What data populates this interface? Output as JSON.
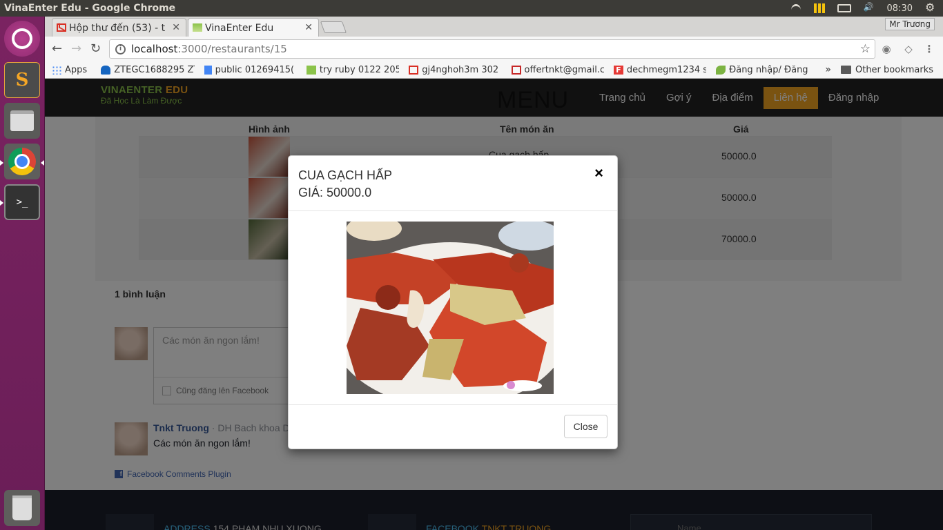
{
  "window": {
    "title": "VinaEnter Edu - Google Chrome"
  },
  "system_tray": {
    "clock": "08:30"
  },
  "launcher": {
    "items": [
      "ubuntu-dash",
      "sublime-text",
      "files",
      "chrome",
      "terminal",
      "trash"
    ]
  },
  "browser": {
    "tabs": [
      {
        "label": "Hộp thư đến (53) - t",
        "icon": "gmail-icon"
      },
      {
        "label": "VinaEnter Edu",
        "icon": "vinaenter-favicon",
        "active": true
      }
    ],
    "profile": "Mr Trương",
    "url": {
      "host": "localhost",
      "path": ":3000/restaurants/15"
    },
    "bookmarks": [
      {
        "label": "Apps",
        "icon": "apps-icon",
        "color": "#4285f4"
      },
      {
        "label": "ZTEGC1688295 ZT",
        "icon": "cloud-icon",
        "color": "#1565c0"
      },
      {
        "label": "public 01269415(",
        "icon": "docs-icon",
        "color": "#4285f4"
      },
      {
        "label": "try ruby 0122 205",
        "icon": "image-icon",
        "color": "#8bc34a"
      },
      {
        "label": "gj4nghoh3m  302",
        "icon": "gmail-icon",
        "color": "#d93025"
      },
      {
        "label": "offertnkt@gmail.c",
        "icon": "mail-icon",
        "color": "#c62828"
      },
      {
        "label": "dechmegm1234  s",
        "icon": "f-icon",
        "color": "#e53935"
      },
      {
        "label": "Đăng nhập/ Đăng",
        "icon": "leaf-icon",
        "color": "#7cb342"
      }
    ],
    "bookmarks_more": "»",
    "other_bookmarks": "Other bookmarks"
  },
  "site": {
    "logo": {
      "line1a": "VINAENTER",
      "line1b": " EDU",
      "line2": "Đã Học Là Làm Được"
    },
    "menu_heading": "MENU",
    "nav": [
      {
        "label": "Trang chủ"
      },
      {
        "label": "Gợi ý"
      },
      {
        "label": "Địa điểm"
      },
      {
        "label": "Liên hệ",
        "active": true
      },
      {
        "label": "Đăng nhập"
      }
    ],
    "table": {
      "headers": {
        "image": "Hình ảnh",
        "name": "Tên món ăn",
        "price": "Giá"
      },
      "rows": [
        {
          "name": "Cua gạch hấp",
          "price": "50000.0"
        },
        {
          "name": "",
          "price": "50000.0"
        },
        {
          "name": "",
          "price": "70000.0"
        }
      ]
    },
    "comments": {
      "count_label": "1 bình luận",
      "input_placeholder": "Các món ăn ngon lắm!",
      "also_post": "Cũng đăng lên Facebook",
      "post": {
        "author": "Tnkt Truong",
        "org": " · DH Bach khoa D",
        "text": "Các món ăn ngon lắm!"
      },
      "plugin_label": "Facebook Comments Plugin"
    },
    "footer": {
      "address_label": "ADDRESS",
      "address_value": "154 PHAM NHU XUONG",
      "facebook_label": "FACEBOOK",
      "facebook_value": "TNKT TRUONG",
      "name_placeholder": "Name"
    }
  },
  "modal": {
    "title": "CUA GẠCH HẤP",
    "price": "GIÁ: 50000.0",
    "close_symbol": "×",
    "close_button": "Close",
    "image_alt": "crab dish photo"
  },
  "colors": {
    "accent_orange": "#f5a623",
    "logo_green": "#8bc34a",
    "nav_bg": "#222222",
    "launcher_purple": "#7a2361"
  }
}
